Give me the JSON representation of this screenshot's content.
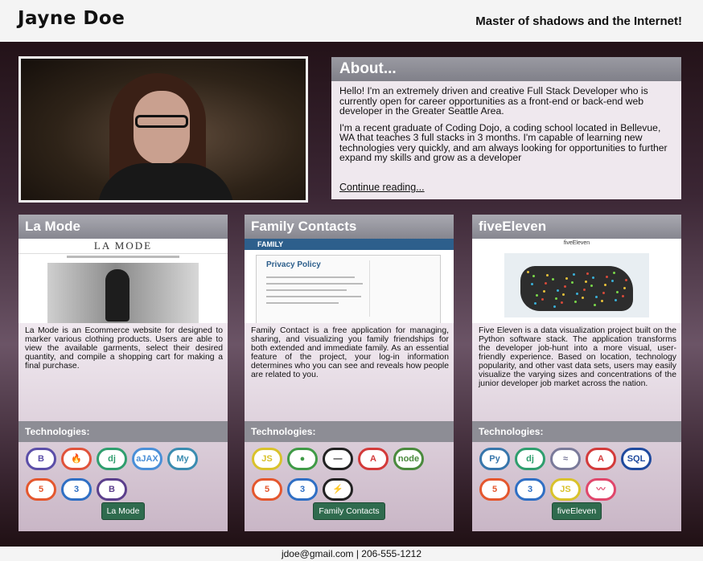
{
  "header": {
    "name": "Jayne Doe",
    "tagline": "Master of shadows and the Internet!"
  },
  "about": {
    "title": "About...",
    "p1": "Hello! I'm an extremely driven and creative Full Stack Developer who is currently open for career opportunities as a front-end or back-end web developer in the Greater Seattle Area.",
    "p2": "I'm a recent graduate of Coding Dojo, a coding school located in Bellevue, WA that teaches 3 full stacks in 3 months. I'm capable of learning new technologies very quickly, and am always looking for opportunities to further expand my skills and grow as a developer",
    "link": "Continue reading..."
  },
  "projects": [
    {
      "title": "La Mode",
      "screenshot_heading": "LA MODE",
      "description": "La Mode is an Ecommerce website for designed to marker various clothing products. Users are able to view the available garments, select their desired quantity, and compile a shopping cart for making a final purchase.",
      "tech_label": "Technologies:",
      "tech_icons": [
        {
          "name": "bootstrap-icon",
          "glyph": "B",
          "color": "#5b4ea8"
        },
        {
          "name": "codeigniter-icon",
          "glyph": "🔥",
          "color": "#e0533b"
        },
        {
          "name": "django-icon",
          "glyph": "dj",
          "color": "#2f9e6e"
        },
        {
          "name": "ajax-icon",
          "glyph": "aJAX",
          "color": "#4a8fd8"
        },
        {
          "name": "mysql-icon",
          "glyph": "My",
          "color": "#3a8cb0"
        },
        {
          "name": "html5-icon",
          "glyph": "5",
          "color": "#e4572e"
        },
        {
          "name": "css3-icon",
          "glyph": "3",
          "color": "#2f6fc4"
        },
        {
          "name": "bootstrap-b-icon",
          "glyph": "B",
          "color": "#5b3f8c"
        }
      ],
      "button": "La Mode"
    },
    {
      "title": "Family Contacts",
      "screenshot_logo": "FAMILY",
      "screenshot_heading": "Privacy Policy",
      "description": "Family Contact is a free application for managing, sharing, and visualizing you family friendships for both extended and immediate family. As an essential feature of the project, your log-in information determines who you can see and reveals how people are related to you.",
      "tech_label": "Technologies:",
      "tech_icons": [
        {
          "name": "javascript-icon",
          "glyph": "JS",
          "color": "#d9c22b"
        },
        {
          "name": "mongodb-icon",
          "glyph": "●",
          "color": "#3f9a46"
        },
        {
          "name": "express-icon",
          "glyph": "—",
          "color": "#222222"
        },
        {
          "name": "angular-icon",
          "glyph": "A",
          "color": "#d33a3a"
        },
        {
          "name": "node-icon",
          "glyph": "node",
          "color": "#4a8a3d"
        },
        {
          "name": "html5-icon",
          "glyph": "5",
          "color": "#e4572e"
        },
        {
          "name": "css3-icon",
          "glyph": "3",
          "color": "#2f6fc4"
        },
        {
          "name": "lightning-icon",
          "glyph": "⚡",
          "color": "#222222"
        }
      ],
      "button": "Family Contacts"
    },
    {
      "title": "fiveEleven",
      "screenshot_heading": "fiveEleven",
      "description": "Five Eleven is a data visualization project built on the Python software stack. The application transforms the developer job-hunt into a more visual, user-friendly experience. Based on location, technology popularity, and other vast data sets, users may easily visualize the varying sizes and concentrations of the junior developer job market across the nation.",
      "tech_label": "Technologies:",
      "tech_icons": [
        {
          "name": "python-icon",
          "glyph": "Py",
          "color": "#3776ab"
        },
        {
          "name": "django-icon",
          "glyph": "dj",
          "color": "#2f9e6e"
        },
        {
          "name": "sqlalchemy-icon",
          "glyph": "≈",
          "color": "#7a7a9a"
        },
        {
          "name": "angular-icon",
          "glyph": "A",
          "color": "#d33a3a"
        },
        {
          "name": "sqlite-icon",
          "glyph": "SQL",
          "color": "#1f4a9e"
        },
        {
          "name": "html5-icon",
          "glyph": "5",
          "color": "#e4572e"
        },
        {
          "name": "css3-icon",
          "glyph": "3",
          "color": "#2f6fc4"
        },
        {
          "name": "javascript-icon",
          "glyph": "JS",
          "color": "#d9c22b"
        },
        {
          "name": "heroku-icon",
          "glyph": "〰",
          "color": "#e0466b"
        }
      ],
      "button": "fiveEleven"
    }
  ],
  "footer": {
    "contact": "jdoe@gmail.com | 206-555-1212"
  }
}
